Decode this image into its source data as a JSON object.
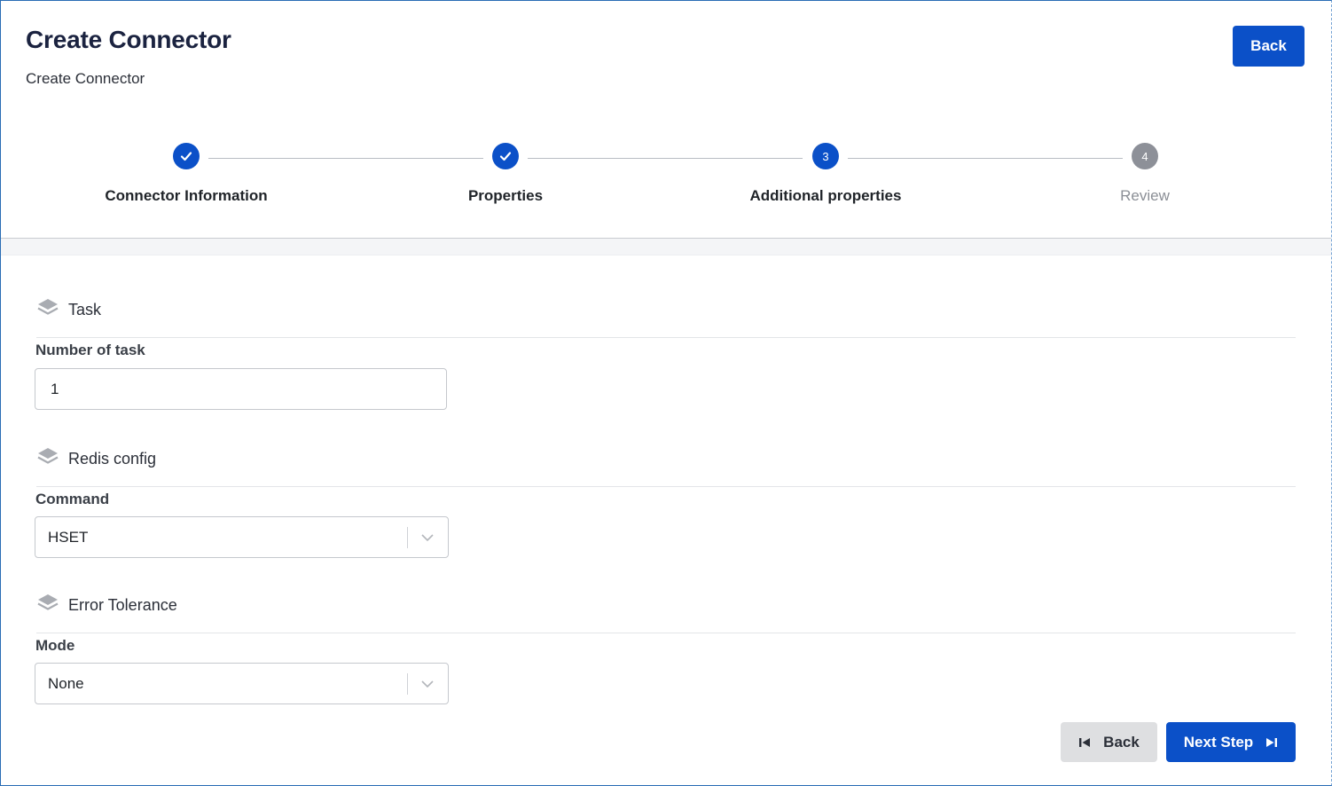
{
  "header": {
    "title": "Create Connector",
    "subtitle": "Create Connector",
    "back_label": "Back"
  },
  "stepper": {
    "steps": [
      {
        "label": "Connector Information",
        "status": "done",
        "marker": ""
      },
      {
        "label": "Properties",
        "status": "done",
        "marker": ""
      },
      {
        "label": "Additional properties",
        "status": "active",
        "marker": "3"
      },
      {
        "label": "Review",
        "status": "pending",
        "marker": "4"
      }
    ]
  },
  "form": {
    "task_section": {
      "title": "Task",
      "number_of_task_label": "Number of task",
      "number_of_task_value": "1"
    },
    "redis_section": {
      "title": "Redis config",
      "command_label": "Command",
      "command_value": "HSET"
    },
    "error_section": {
      "title": "Error Tolerance",
      "mode_label": "Mode",
      "mode_value": "None"
    }
  },
  "footer": {
    "back_label": "Back",
    "next_label": "Next Step"
  },
  "colors": {
    "primary": "#0b50c8",
    "pending": "#8d9098",
    "title": "#1b2340"
  }
}
